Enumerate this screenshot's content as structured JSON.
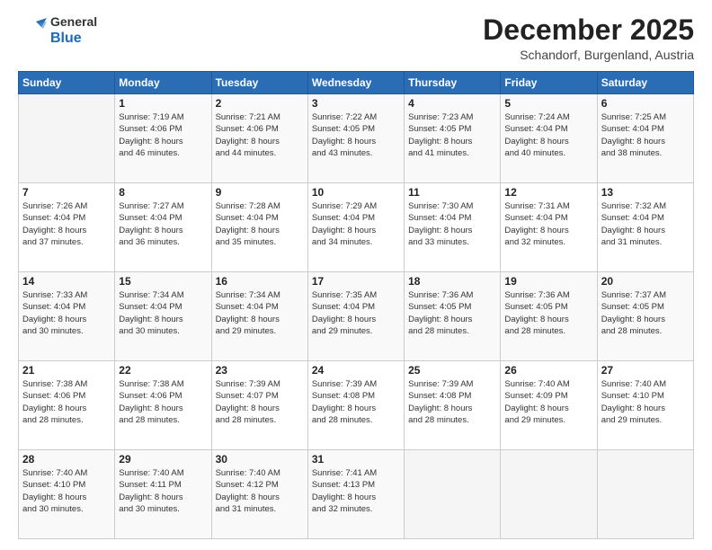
{
  "header": {
    "logo_general": "General",
    "logo_blue": "Blue",
    "month": "December 2025",
    "location": "Schandorf, Burgenland, Austria"
  },
  "days_of_week": [
    "Sunday",
    "Monday",
    "Tuesday",
    "Wednesday",
    "Thursday",
    "Friday",
    "Saturday"
  ],
  "weeks": [
    [
      {
        "day": "",
        "info": ""
      },
      {
        "day": "1",
        "info": "Sunrise: 7:19 AM\nSunset: 4:06 PM\nDaylight: 8 hours\nand 46 minutes."
      },
      {
        "day": "2",
        "info": "Sunrise: 7:21 AM\nSunset: 4:06 PM\nDaylight: 8 hours\nand 44 minutes."
      },
      {
        "day": "3",
        "info": "Sunrise: 7:22 AM\nSunset: 4:05 PM\nDaylight: 8 hours\nand 43 minutes."
      },
      {
        "day": "4",
        "info": "Sunrise: 7:23 AM\nSunset: 4:05 PM\nDaylight: 8 hours\nand 41 minutes."
      },
      {
        "day": "5",
        "info": "Sunrise: 7:24 AM\nSunset: 4:04 PM\nDaylight: 8 hours\nand 40 minutes."
      },
      {
        "day": "6",
        "info": "Sunrise: 7:25 AM\nSunset: 4:04 PM\nDaylight: 8 hours\nand 38 minutes."
      }
    ],
    [
      {
        "day": "7",
        "info": "Sunrise: 7:26 AM\nSunset: 4:04 PM\nDaylight: 8 hours\nand 37 minutes."
      },
      {
        "day": "8",
        "info": "Sunrise: 7:27 AM\nSunset: 4:04 PM\nDaylight: 8 hours\nand 36 minutes."
      },
      {
        "day": "9",
        "info": "Sunrise: 7:28 AM\nSunset: 4:04 PM\nDaylight: 8 hours\nand 35 minutes."
      },
      {
        "day": "10",
        "info": "Sunrise: 7:29 AM\nSunset: 4:04 PM\nDaylight: 8 hours\nand 34 minutes."
      },
      {
        "day": "11",
        "info": "Sunrise: 7:30 AM\nSunset: 4:04 PM\nDaylight: 8 hours\nand 33 minutes."
      },
      {
        "day": "12",
        "info": "Sunrise: 7:31 AM\nSunset: 4:04 PM\nDaylight: 8 hours\nand 32 minutes."
      },
      {
        "day": "13",
        "info": "Sunrise: 7:32 AM\nSunset: 4:04 PM\nDaylight: 8 hours\nand 31 minutes."
      }
    ],
    [
      {
        "day": "14",
        "info": "Sunrise: 7:33 AM\nSunset: 4:04 PM\nDaylight: 8 hours\nand 30 minutes."
      },
      {
        "day": "15",
        "info": "Sunrise: 7:34 AM\nSunset: 4:04 PM\nDaylight: 8 hours\nand 30 minutes."
      },
      {
        "day": "16",
        "info": "Sunrise: 7:34 AM\nSunset: 4:04 PM\nDaylight: 8 hours\nand 29 minutes."
      },
      {
        "day": "17",
        "info": "Sunrise: 7:35 AM\nSunset: 4:04 PM\nDaylight: 8 hours\nand 29 minutes."
      },
      {
        "day": "18",
        "info": "Sunrise: 7:36 AM\nSunset: 4:05 PM\nDaylight: 8 hours\nand 28 minutes."
      },
      {
        "day": "19",
        "info": "Sunrise: 7:36 AM\nSunset: 4:05 PM\nDaylight: 8 hours\nand 28 minutes."
      },
      {
        "day": "20",
        "info": "Sunrise: 7:37 AM\nSunset: 4:05 PM\nDaylight: 8 hours\nand 28 minutes."
      }
    ],
    [
      {
        "day": "21",
        "info": "Sunrise: 7:38 AM\nSunset: 4:06 PM\nDaylight: 8 hours\nand 28 minutes."
      },
      {
        "day": "22",
        "info": "Sunrise: 7:38 AM\nSunset: 4:06 PM\nDaylight: 8 hours\nand 28 minutes."
      },
      {
        "day": "23",
        "info": "Sunrise: 7:39 AM\nSunset: 4:07 PM\nDaylight: 8 hours\nand 28 minutes."
      },
      {
        "day": "24",
        "info": "Sunrise: 7:39 AM\nSunset: 4:08 PM\nDaylight: 8 hours\nand 28 minutes."
      },
      {
        "day": "25",
        "info": "Sunrise: 7:39 AM\nSunset: 4:08 PM\nDaylight: 8 hours\nand 28 minutes."
      },
      {
        "day": "26",
        "info": "Sunrise: 7:40 AM\nSunset: 4:09 PM\nDaylight: 8 hours\nand 29 minutes."
      },
      {
        "day": "27",
        "info": "Sunrise: 7:40 AM\nSunset: 4:10 PM\nDaylight: 8 hours\nand 29 minutes."
      }
    ],
    [
      {
        "day": "28",
        "info": "Sunrise: 7:40 AM\nSunset: 4:10 PM\nDaylight: 8 hours\nand 30 minutes."
      },
      {
        "day": "29",
        "info": "Sunrise: 7:40 AM\nSunset: 4:11 PM\nDaylight: 8 hours\nand 30 minutes."
      },
      {
        "day": "30",
        "info": "Sunrise: 7:40 AM\nSunset: 4:12 PM\nDaylight: 8 hours\nand 31 minutes."
      },
      {
        "day": "31",
        "info": "Sunrise: 7:41 AM\nSunset: 4:13 PM\nDaylight: 8 hours\nand 32 minutes."
      },
      {
        "day": "",
        "info": ""
      },
      {
        "day": "",
        "info": ""
      },
      {
        "day": "",
        "info": ""
      }
    ]
  ]
}
